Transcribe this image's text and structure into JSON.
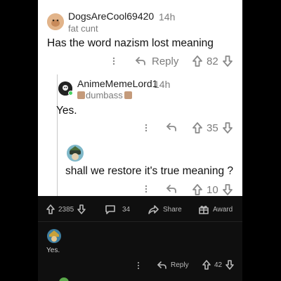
{
  "comments": [
    {
      "username": "DogsAreCool69420",
      "time": "14h",
      "flair": "fat cunt",
      "body": "Has the word nazism lost meaning",
      "reply_label": "Reply",
      "votes": "82"
    },
    {
      "username": "AnimeMemeLord1",
      "time": "14h",
      "flair": "dumbass",
      "body": "Yes.",
      "votes": "35"
    },
    {
      "body": "shall we restore it's true meaning ?",
      "votes": "10"
    }
  ],
  "post_bar": {
    "upvotes": "2385",
    "comments": "34",
    "share_label": "Share",
    "award_label": "Award"
  },
  "bottom_comment": {
    "body": "Yes.",
    "reply_label": "Reply",
    "votes": "42"
  },
  "colors": {
    "light_bg": "#ffffff",
    "dark_bg": "#0f0f0f",
    "outer_bg": "#000000",
    "muted_text": "#7c7c7c",
    "online_dot": "#46d160"
  },
  "icons": [
    "more-icon",
    "reply-icon",
    "upvote-icon",
    "downvote-icon",
    "comment-icon",
    "share-icon",
    "award-icon"
  ]
}
